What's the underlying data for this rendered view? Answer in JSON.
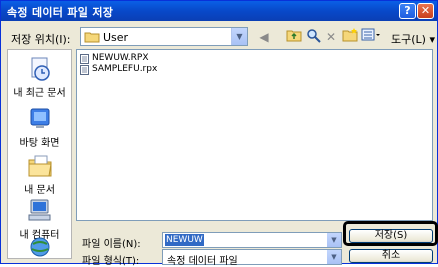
{
  "window": {
    "title": "속정 데이터 파일 저장",
    "help_label": "?",
    "close_label": "✕"
  },
  "toolbar": {
    "save_in_label": "저장 위치(I):",
    "save_in_value": "User",
    "tools_label": "도구(L) ▾"
  },
  "places": [
    {
      "label": "내 최근 문서",
      "icon": "recent-documents-icon"
    },
    {
      "label": "바탕 화면",
      "icon": "desktop-icon"
    },
    {
      "label": "내 문서",
      "icon": "my-documents-icon"
    },
    {
      "label": "내 컴퓨터",
      "icon": "my-computer-icon"
    },
    {
      "label": "",
      "icon": "network-places-icon"
    }
  ],
  "files": [
    {
      "name": "NEWUW.RPX",
      "icon": "file-icon"
    },
    {
      "name": "SAMPLEFU.rpx",
      "icon": "file-icon"
    }
  ],
  "bottom": {
    "filename_label": "파일 이름(N):",
    "filename_value": "NEWUW",
    "filetype_label": "파일 형식(T):",
    "filetype_value": "속정 데이터 파일",
    "save_label": "저장(S)",
    "cancel_label": "취소"
  },
  "colors": {
    "title_bar": "#0a5fe6",
    "dialog_bg": "#ece9d8",
    "selection": "#316ac5",
    "highlight_border": "#000000"
  }
}
